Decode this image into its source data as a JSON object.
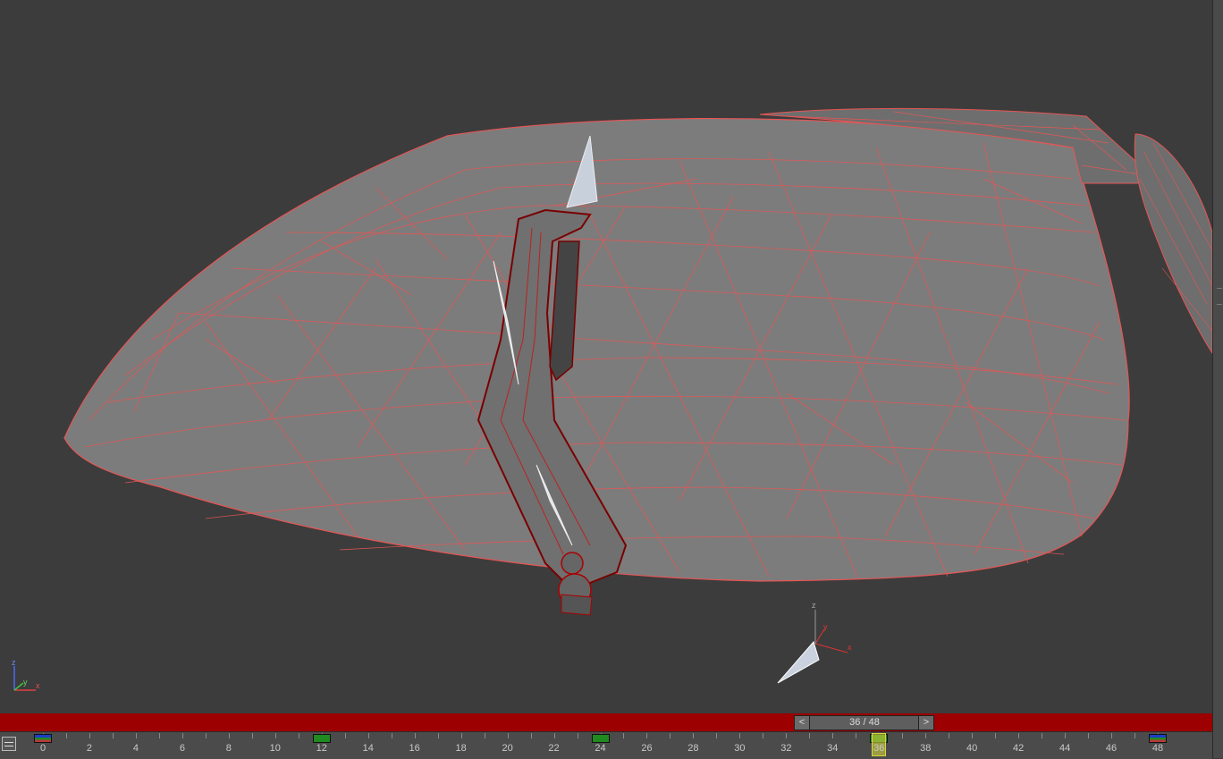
{
  "viewport": {
    "axis_gizmo": {
      "x": "x",
      "y": "y",
      "z": "z"
    },
    "object_axis": {
      "x": "x",
      "y": "y",
      "z": "z"
    }
  },
  "time_slider": {
    "prev_label": "<",
    "next_label": ">",
    "frame_text": "36 / 48",
    "current_frame": 36,
    "total_frames": 48
  },
  "track_bar": {
    "labels": [
      "0",
      "2",
      "4",
      "6",
      "8",
      "10",
      "12",
      "14",
      "16",
      "18",
      "20",
      "22",
      "24",
      "26",
      "28",
      "30",
      "32",
      "34",
      "36",
      "38",
      "40",
      "42",
      "44",
      "46",
      "48"
    ],
    "keyframes": [
      0,
      12,
      24,
      36,
      48
    ]
  },
  "colors": {
    "viewport_bg": "#3c3c3c",
    "mesh_fill": "#7a7a7a",
    "wire": "#e85555",
    "time_bar": "#9c0000",
    "key_green": "#1f8a1f"
  }
}
